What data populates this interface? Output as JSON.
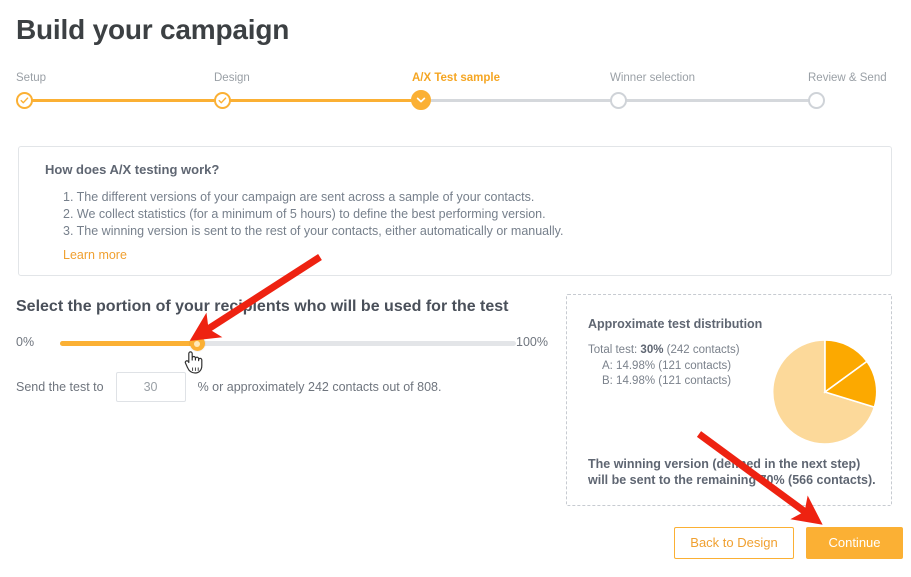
{
  "page": {
    "title": "Build your campaign"
  },
  "stepper": {
    "steps": [
      {
        "label": "Setup",
        "state": "done",
        "icon": "check-icon"
      },
      {
        "label": "Design",
        "state": "done",
        "icon": "check-icon"
      },
      {
        "label": "A/X Test sample",
        "state": "current",
        "icon": "chevron-down-icon"
      },
      {
        "label": "Winner selection",
        "state": "upcoming",
        "icon": ""
      },
      {
        "label": "Review & Send",
        "state": "upcoming",
        "icon": ""
      }
    ],
    "accent_color": "#fbb034",
    "inactive_color": "#cfd3d8"
  },
  "info_box": {
    "title": "How does A/X testing work?",
    "items": [
      "1. The different versions of your campaign are sent across a sample of your contacts.",
      "2. We collect statistics (for a minimum of 5 hours) to define the best performing version.",
      "3. The winning version is sent to the rest of your contacts, either automatically or manually."
    ],
    "learn_more": "Learn more"
  },
  "portion": {
    "heading": "Select the portion of your recipients who will be used for the test",
    "slider_min_label": "0%",
    "slider_max_label": "100%",
    "slider_value": 30,
    "send_label": "Send the test to",
    "input_value": "30",
    "input_placeholder": "30",
    "suffix": "% or approximately 242 contacts out of 808."
  },
  "distribution": {
    "title": "Approximate test distribution",
    "total_line_prefix": "Total test: ",
    "total_line_bold": "30%",
    "total_line_suffix": " (242 contacts)",
    "variant_a": "A: 14.98% (121 contacts)",
    "variant_b": "B: 14.98% (121 contacts)",
    "note": "The winning version (defined in the next step) will be sent to the remaining 70% (566 contacts).",
    "colors": {
      "variant": "#fca900",
      "remainder": "#fcd99a"
    }
  },
  "chart_data": {
    "type": "pie",
    "title": "Approximate test distribution",
    "labels": [
      "A",
      "B",
      "Remaining (winner)"
    ],
    "values": [
      14.98,
      14.98,
      70.04
    ],
    "colors": [
      "#fca900",
      "#fca900",
      "#fcd99a"
    ],
    "contacts": [
      121,
      121,
      566
    ],
    "total_contacts": 808,
    "start_angle_deg": 0,
    "legend": "none"
  },
  "footer": {
    "back_label": "Back to Design",
    "continue_label": "Continue"
  },
  "annotations": {
    "arrow_color": "#ee2211",
    "arrow_1_target": "slider-thumb",
    "arrow_2_target": "continue-button"
  }
}
